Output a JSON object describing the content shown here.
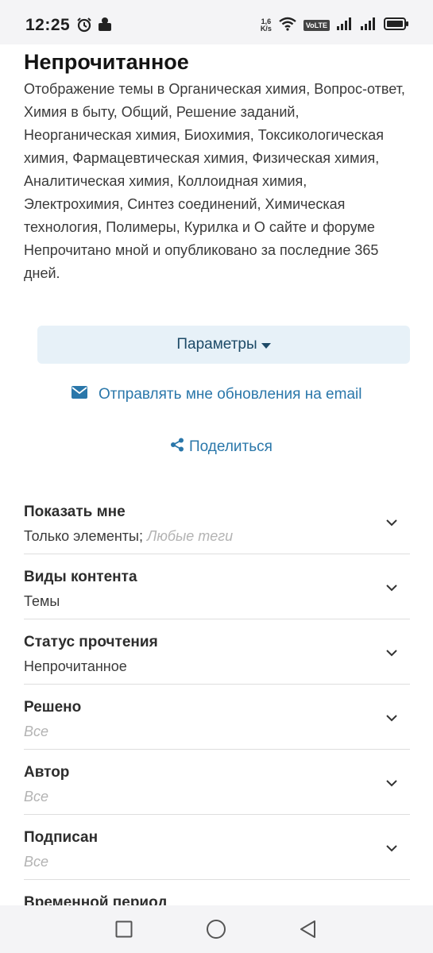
{
  "status_bar": {
    "time": "12:25",
    "net_speed_value": "1,6",
    "net_speed_unit": "K/s",
    "volte_label": "VoLTE",
    "icons": [
      "alarm-icon",
      "app-notification-icon",
      "wifi-icon",
      "volte-icon",
      "signal-icon",
      "signal-icon",
      "battery-icon"
    ]
  },
  "page": {
    "title": "Непрочитанное",
    "description": "Отображение темы в Органическая химия, Вопрос-ответ, Химия в быту, Общий, Решение заданий, Неорганическая химия, Биохимия, Токсикологическая химия, Фармацевтическая химия, Физическая химия, Аналитическая химия, Коллоидная химия, Электрохимия, Синтез соединений, Химическая технология, Полимеры, Курилка и О сайте и форуме Непрочитано мной и опубликовано за последние 365 дней."
  },
  "actions": {
    "parameters_label": "Параметры",
    "email_label": "Отправлять мне обновления на email",
    "share_label": "Поделиться"
  },
  "filters": [
    {
      "label": "Показать мне",
      "value": "Только элементы;",
      "hint": "Любые теги"
    },
    {
      "label": "Виды контента",
      "value": "Темы",
      "hint": ""
    },
    {
      "label": "Статус прочтения",
      "value": "Непрочитанное",
      "hint": ""
    },
    {
      "label": "Решено",
      "value": "",
      "hint": "Все"
    },
    {
      "label": "Автор",
      "value": "",
      "hint": "Все"
    },
    {
      "label": "Подписан",
      "value": "",
      "hint": "Все"
    },
    {
      "label": "Временной период",
      "value": "",
      "hint": ""
    }
  ],
  "colors": {
    "accent": "#2a77aa",
    "button_bg": "#e7f1f8",
    "button_text": "#1d4a67",
    "muted": "#b3b3b3",
    "divider": "#dedede"
  }
}
